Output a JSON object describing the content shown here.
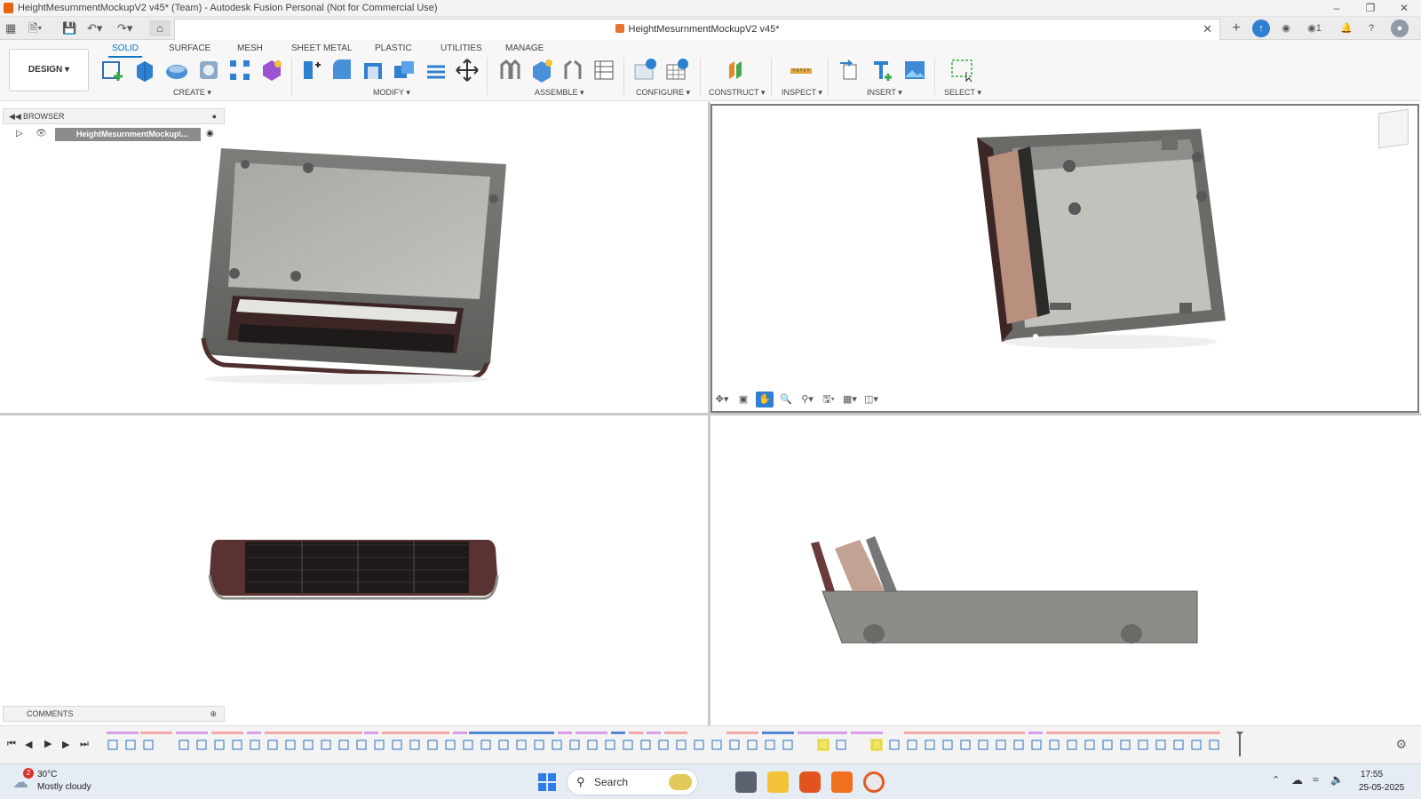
{
  "window": {
    "title": "HeightMesurnmentMockupV2 v45* (Team) - Autodesk Fusion Personal (Not for Commercial Use)"
  },
  "document_tab": {
    "title": "HeightMesurnmentMockupV2 v45*"
  },
  "ribbon": {
    "workspace": "DESIGN",
    "tabs": [
      "SOLID",
      "SURFACE",
      "MESH",
      "SHEET METAL",
      "PLASTIC",
      "UTILITIES",
      "MANAGE"
    ],
    "groups": {
      "create": "CREATE",
      "modify": "MODIFY",
      "assemble": "ASSEMBLE",
      "configure": "CONFIGURE",
      "construct": "CONSTRUCT",
      "inspect": "INSPECT",
      "insert": "INSERT",
      "select": "SELECT"
    }
  },
  "browser": {
    "title": "BROWSER",
    "root_node": "HeightMesurnmentMockup\\..."
  },
  "comments": {
    "title": "COMMENTS"
  },
  "notifications": {
    "badge": "1"
  },
  "taskbar": {
    "weather_temp": "30°C",
    "weather_desc": "Mostly cloudy",
    "weather_badge": "2",
    "search_placeholder": "Search",
    "time": "17:55",
    "date": "25-05-2025"
  },
  "colors": {
    "accent": "#0f73c4",
    "model_shell": "#8a8a86",
    "model_inner": "#bdbdb8",
    "model_edge": "#4a4a48",
    "pcb": "#b08a7a",
    "active_vp_border": "#7b7b7b"
  }
}
